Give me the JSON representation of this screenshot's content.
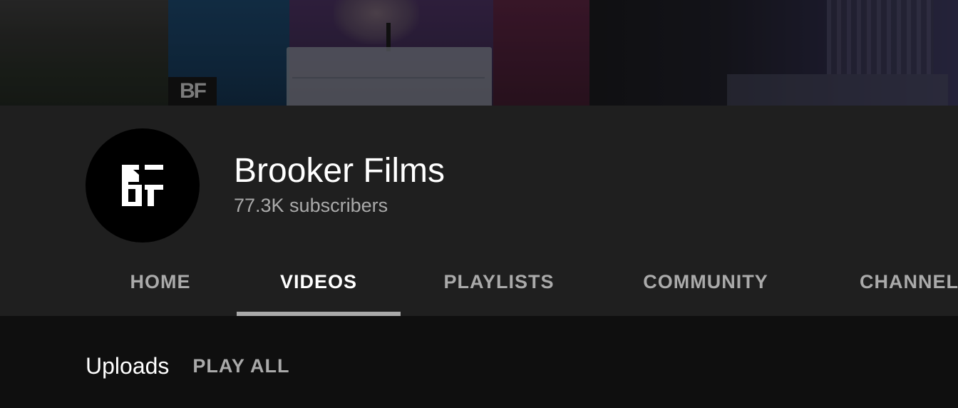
{
  "channel": {
    "name": "Brooker Films",
    "subscribers": "77.3K subscribers",
    "avatar_logo_text": "BF"
  },
  "banner": {
    "logo_text": "BF"
  },
  "tabs": [
    {
      "label": "HOME",
      "active": false
    },
    {
      "label": "VIDEOS",
      "active": true
    },
    {
      "label": "PLAYLISTS",
      "active": false
    },
    {
      "label": "COMMUNITY",
      "active": false
    },
    {
      "label": "CHANNELS",
      "active": false
    }
  ],
  "content": {
    "section_title": "Uploads",
    "play_all_label": "PLAY ALL"
  },
  "colors": {
    "page_background": "#0f0f0f",
    "header_background": "#1f1f1f",
    "text_primary": "#ffffff",
    "text_secondary": "#aaaaaa",
    "tab_underline": "#aaaaaa"
  }
}
